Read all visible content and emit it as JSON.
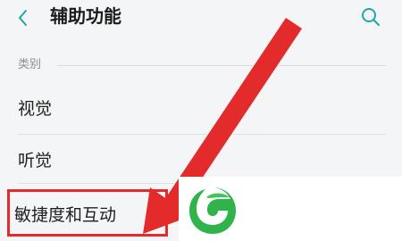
{
  "header": {
    "title": "辅助功能",
    "back_icon": "chevron-left-icon",
    "search_icon": "search-icon"
  },
  "category": {
    "label": "类别"
  },
  "items": [
    {
      "label": "视觉"
    },
    {
      "label": "听觉"
    },
    {
      "label": "敏捷度和互动"
    }
  ],
  "colors": {
    "accent": "#e32b2b",
    "teal": "#20a8a0",
    "logo_green": "#2fb34a"
  },
  "logo_icon": "leaf-logo-icon"
}
